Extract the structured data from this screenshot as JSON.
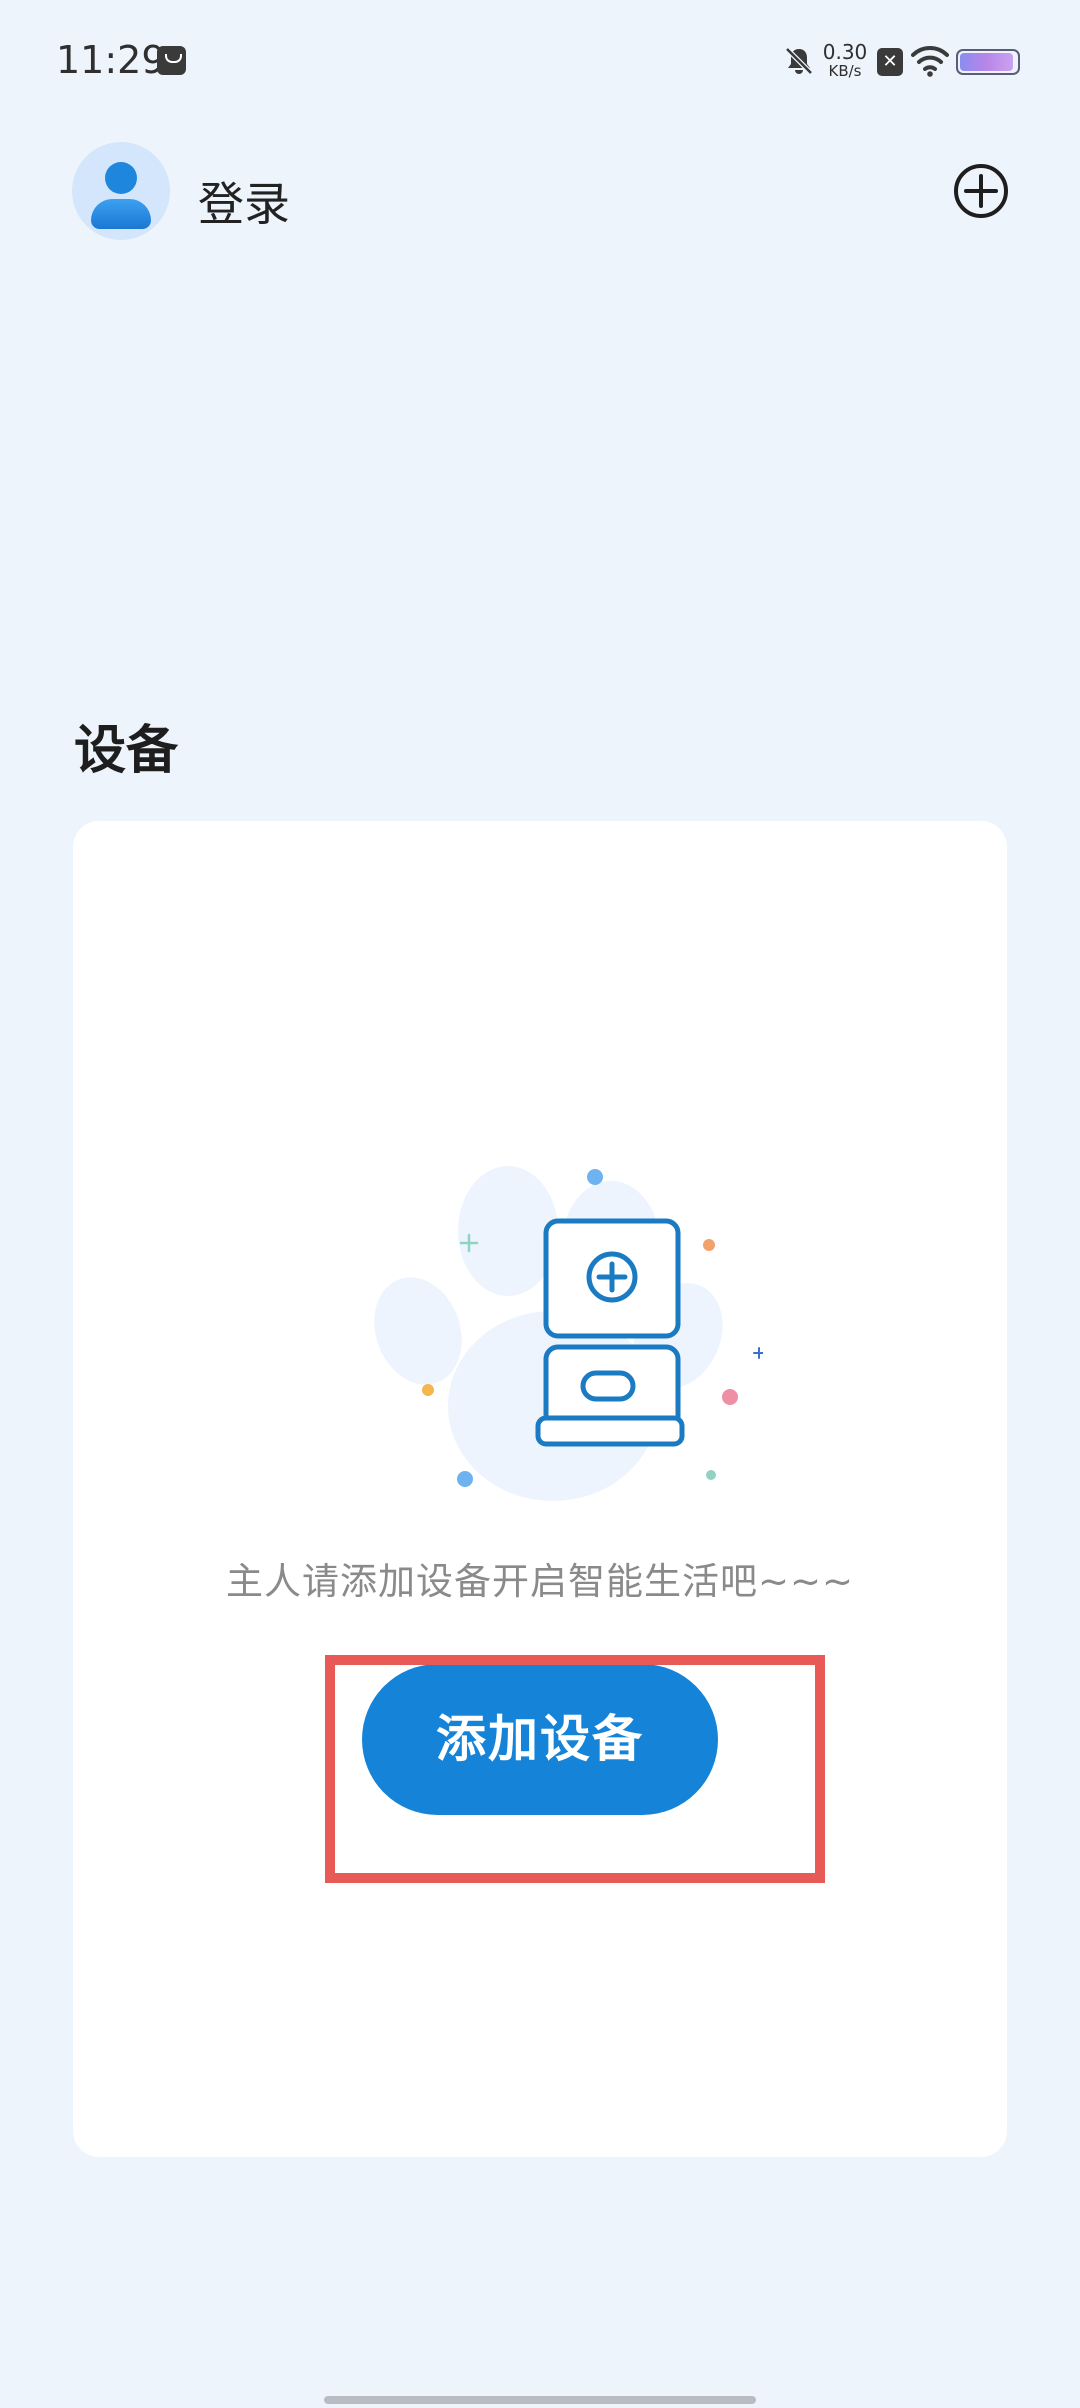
{
  "status_bar": {
    "time": "11:29",
    "net_speed_value": "0.30",
    "net_speed_unit": "KB/s",
    "sim_icon": "sim-x-icon",
    "battery_level": 0.95
  },
  "header": {
    "login_label": "登录",
    "avatar_icon": "user-avatar-icon",
    "add_icon": "plus-circle-icon"
  },
  "devices_section": {
    "title": "设备",
    "empty_message": "主人请添加设备开启智能生活吧~~~",
    "add_device_button": "添加设备",
    "illustration_icon": "pet-feeder-illustration"
  },
  "colors": {
    "background": "#eef4fc",
    "accent": "#1584d8",
    "highlight": "#e85a55"
  }
}
